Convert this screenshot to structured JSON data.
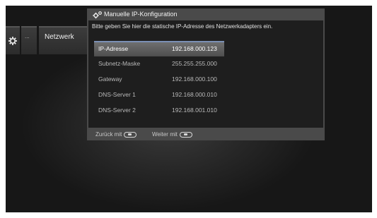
{
  "sidebar": {
    "gear_icon": "gear-icon",
    "dots_label": "...",
    "network_label": "Netzwerk"
  },
  "dialog": {
    "title_icon": "gears-icon",
    "title": "Manuelle IP-Konfiguration",
    "instruction": "Bitte geben Sie hier die statische IP-Adresse des Netzwerkadapters ein.",
    "rows": [
      {
        "label": "IP-Adresse",
        "value": "192.168.000.123",
        "active": true
      },
      {
        "label": "Subnetz-Maske",
        "value": "255.255.255.000"
      },
      {
        "label": "Gateway",
        "value": "192.168.000.100"
      },
      {
        "label": "DNS-Server 1",
        "value": "192.168.000.010"
      },
      {
        "label": "DNS-Server 2",
        "value": "192.168.001.010"
      }
    ],
    "footer": {
      "back_label": "Zurück mit",
      "next_label": "Weiter mit"
    }
  },
  "colors": {
    "accent": "#7a8fb5",
    "dialog_frame": "#4a4a4a",
    "dialog_body": "#1e1e1e"
  }
}
